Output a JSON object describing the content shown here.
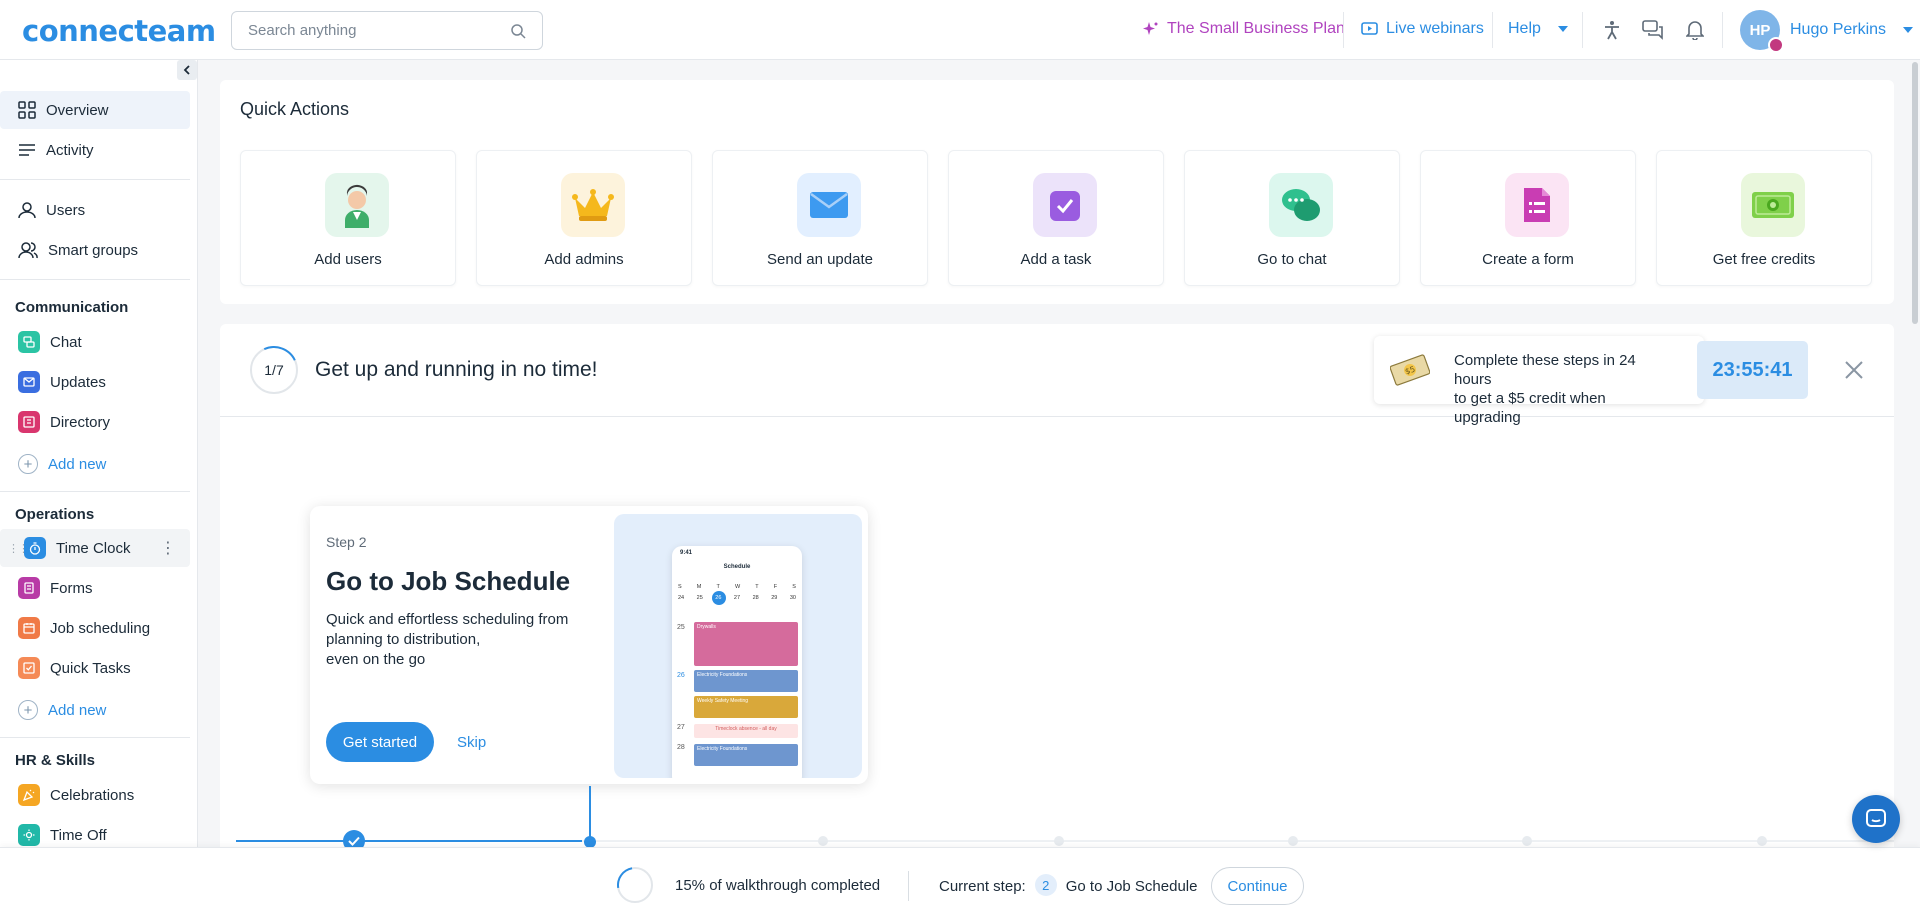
{
  "header": {
    "logo": "connecteam",
    "search_placeholder": "Search anything",
    "plan_label": "The Small Business Plan",
    "webinars_label": "Live webinars",
    "help_label": "Help",
    "user_initials": "HP",
    "user_name": "Hugo Perkins"
  },
  "sidebar": {
    "overview": "Overview",
    "activity": "Activity",
    "users": "Users",
    "smart_groups": "Smart groups",
    "communication_title": "Communication",
    "communication": [
      "Chat",
      "Updates",
      "Directory"
    ],
    "add_new": "Add new",
    "operations_title": "Operations",
    "operations": [
      "Time Clock",
      "Forms",
      "Job scheduling",
      "Quick Tasks"
    ],
    "hr_title": "HR & Skills",
    "hr": [
      "Celebrations",
      "Time Off"
    ]
  },
  "quick_actions": {
    "title": "Quick Actions",
    "items": [
      "Add users",
      "Add admins",
      "Send an update",
      "Add a task",
      "Go to chat",
      "Create a form",
      "Get free credits"
    ]
  },
  "onboarding": {
    "progress": "1/7",
    "title": "Get up and running in no time!",
    "credit_line1": "Complete these steps in 24 hours",
    "credit_line2": "to get a $5 credit when upgrading",
    "timer": "23:55:41",
    "step_label": "Step 2",
    "step_title": "Go to Job Schedule",
    "step_desc_1": "Quick and effortless scheduling from",
    "step_desc_2": "planning to distribution,",
    "step_desc_3": "even on the go",
    "get_started": "Get started",
    "skip": "Skip",
    "phone": {
      "time": "9:41",
      "title": "Schedule",
      "weekdays": [
        "S",
        "M",
        "T",
        "W",
        "T",
        "F",
        "S"
      ],
      "days": [
        "24",
        "25",
        "26",
        "27",
        "28",
        "29",
        "30"
      ],
      "dates": [
        "25",
        "26",
        "27",
        "28"
      ],
      "shifts": [
        "Drywalls",
        "Electricity Foundations",
        "Weekly Safety Meeting",
        "Timeclock absence - all day",
        "Electricity Foundations"
      ]
    }
  },
  "walkthrough": {
    "percent_text": "15% of walkthrough completed",
    "current_step_label": "Current step:",
    "current_step_num": "2",
    "current_step_name": "Go to Job Schedule",
    "continue": "Continue"
  },
  "colors": {
    "primary": "#2b8de2",
    "plan": "#b043bf"
  }
}
